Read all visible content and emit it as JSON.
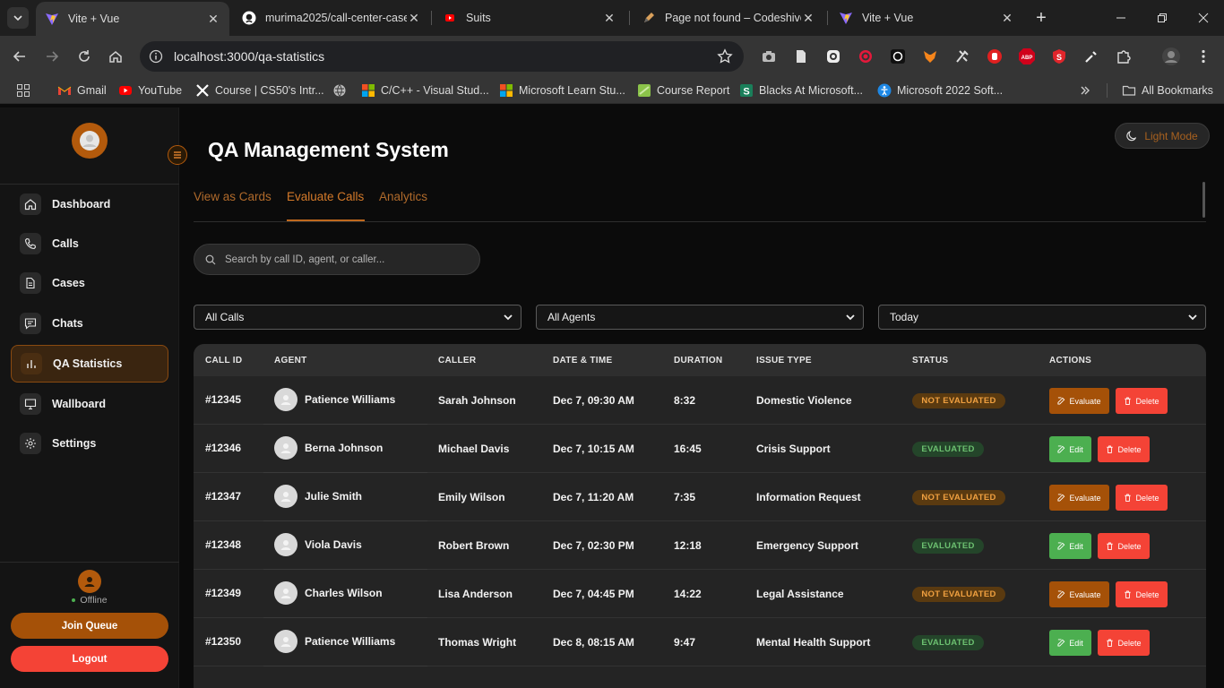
{
  "browser": {
    "tabs": [
      {
        "title": "Vite + Vue",
        "active": true,
        "icon": "vite-icon"
      },
      {
        "title": "murima2025/call-center-case",
        "active": false,
        "icon": "github-icon"
      },
      {
        "title": "Suits",
        "active": false,
        "icon": "youtube-icon"
      },
      {
        "title": "Page not found – Codeshive",
        "active": false,
        "icon": "pen-icon"
      },
      {
        "title": "Vite + Vue",
        "active": false,
        "icon": "vite-icon"
      }
    ],
    "url": "localhost:3000/qa-statistics",
    "bookmarks": [
      {
        "label": "Gmail",
        "icon": "gmail-icon"
      },
      {
        "label": "YouTube",
        "icon": "youtube-icon"
      },
      {
        "label": "Course | CS50's Intr...",
        "icon": "x-icon"
      },
      {
        "label": "",
        "icon": "globe-icon"
      },
      {
        "label": "C/C++ - Visual Stud...",
        "icon": "microsoft-icon"
      },
      {
        "label": "Microsoft Learn Stu...",
        "icon": "microsoft-icon"
      },
      {
        "label": "Course Report",
        "icon": "course-report-icon"
      },
      {
        "label": "Blacks At Microsoft...",
        "icon": "s-icon"
      },
      {
        "label": "Microsoft 2022 Soft...",
        "icon": "accessibility-icon"
      }
    ],
    "all_bookmarks": "All Bookmarks"
  },
  "sidebar": {
    "items": [
      {
        "label": "Dashboard",
        "icon": "home-icon",
        "active": false
      },
      {
        "label": "Calls",
        "icon": "phone-icon",
        "active": false
      },
      {
        "label": "Cases",
        "icon": "document-icon",
        "active": false
      },
      {
        "label": "Chats",
        "icon": "chat-icon",
        "active": false
      },
      {
        "label": "QA Statistics",
        "icon": "bar-chart-icon",
        "active": true
      },
      {
        "label": "Wallboard",
        "icon": "monitor-icon",
        "active": false
      },
      {
        "label": "Settings",
        "icon": "gear-icon",
        "active": false
      }
    ],
    "status": "Offline",
    "join_queue": "Join Queue",
    "logout": "Logout"
  },
  "main": {
    "title": "QA Management System",
    "theme_toggle": "Light Mode",
    "tabs": [
      "View as Cards",
      "Evaluate Calls",
      "Analytics"
    ],
    "active_tab": "Evaluate Calls",
    "search_placeholder": "Search by call ID, agent, or caller...",
    "filters": [
      "All Calls",
      "All Agents",
      "Today"
    ]
  },
  "table": {
    "columns": [
      "CALL ID",
      "AGENT",
      "CALLER",
      "DATE & TIME",
      "DURATION",
      "ISSUE TYPE",
      "STATUS",
      "ACTIONS"
    ],
    "rows": [
      {
        "id": "#12345",
        "agent": "Patience Williams",
        "caller": "Sarah Johnson",
        "datetime": "Dec 7, 09:30 AM",
        "duration": "8:32",
        "issue": "Domestic Violence",
        "status": "NOT EVALUATED",
        "evaluated": false,
        "primary_action": "Evaluate",
        "delete": "Delete"
      },
      {
        "id": "#12346",
        "agent": "Berna Johnson",
        "caller": "Michael Davis",
        "datetime": "Dec 7, 10:15 AM",
        "duration": "16:45",
        "issue": "Crisis Support",
        "status": "EVALUATED",
        "evaluated": true,
        "primary_action": "Edit",
        "delete": "Delete"
      },
      {
        "id": "#12347",
        "agent": "Julie Smith",
        "caller": "Emily Wilson",
        "datetime": "Dec 7, 11:20 AM",
        "duration": "7:35",
        "issue": "Information Request",
        "status": "NOT EVALUATED",
        "evaluated": false,
        "primary_action": "Evaluate",
        "delete": "Delete"
      },
      {
        "id": "#12348",
        "agent": "Viola Davis",
        "caller": "Robert Brown",
        "datetime": "Dec 7, 02:30 PM",
        "duration": "12:18",
        "issue": "Emergency Support",
        "status": "EVALUATED",
        "evaluated": true,
        "primary_action": "Edit",
        "delete": "Delete"
      },
      {
        "id": "#12349",
        "agent": "Charles Wilson",
        "caller": "Lisa Anderson",
        "datetime": "Dec 7, 04:45 PM",
        "duration": "14:22",
        "issue": "Legal Assistance",
        "status": "NOT EVALUATED",
        "evaluated": false,
        "primary_action": "Evaluate",
        "delete": "Delete"
      },
      {
        "id": "#12350",
        "agent": "Patience Williams",
        "caller": "Thomas Wright",
        "datetime": "Dec 8, 08:15 AM",
        "duration": "9:47",
        "issue": "Mental Health Support",
        "status": "EVALUATED",
        "evaluated": true,
        "primary_action": "Edit",
        "delete": "Delete"
      }
    ]
  },
  "colors": {
    "accent": "#a55108",
    "evaluated_green": "#4caf50",
    "delete_red": "#f44336",
    "not_evaluated_text": "#f0a040"
  }
}
